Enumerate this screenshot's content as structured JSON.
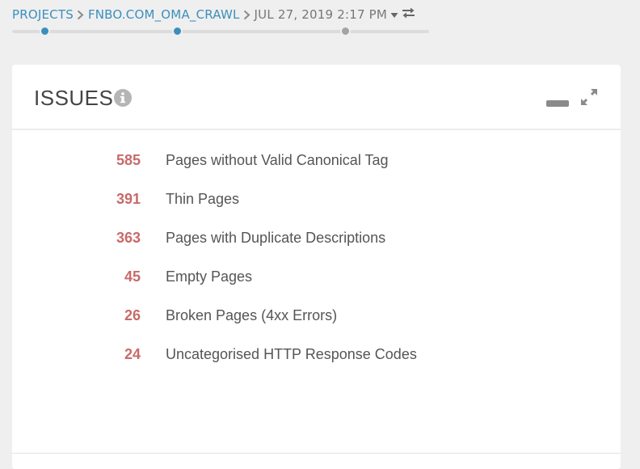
{
  "breadcrumb": {
    "projects": "PROJECTS",
    "project": "FNBO.COM_OMA_CRAWL",
    "crawl_date": "JUL 27, 2019 2:17 PM"
  },
  "icons": {
    "separator": "chevron-right-icon",
    "dropdown": "caret-down-icon",
    "swap": "swap-arrows-icon",
    "info": "info-icon",
    "minimize": "minimize-icon",
    "expand": "expand-icon"
  },
  "timeline": {
    "points": [
      "active",
      "active",
      "inactive"
    ]
  },
  "panel": {
    "title": "ISSUES",
    "issues": [
      {
        "count": "585",
        "label": "Pages without Valid Canonical Tag"
      },
      {
        "count": "391",
        "label": "Thin Pages"
      },
      {
        "count": "363",
        "label": "Pages with Duplicate Descriptions"
      },
      {
        "count": "45",
        "label": "Empty Pages"
      },
      {
        "count": "26",
        "label": "Broken Pages (4xx Errors)"
      },
      {
        "count": "24",
        "label": "Uncategorised HTTP Response Codes"
      }
    ]
  },
  "colors": {
    "link": "#3a8fbd",
    "count": "#c86a6a",
    "background": "#efefef",
    "panel": "#ffffff"
  }
}
